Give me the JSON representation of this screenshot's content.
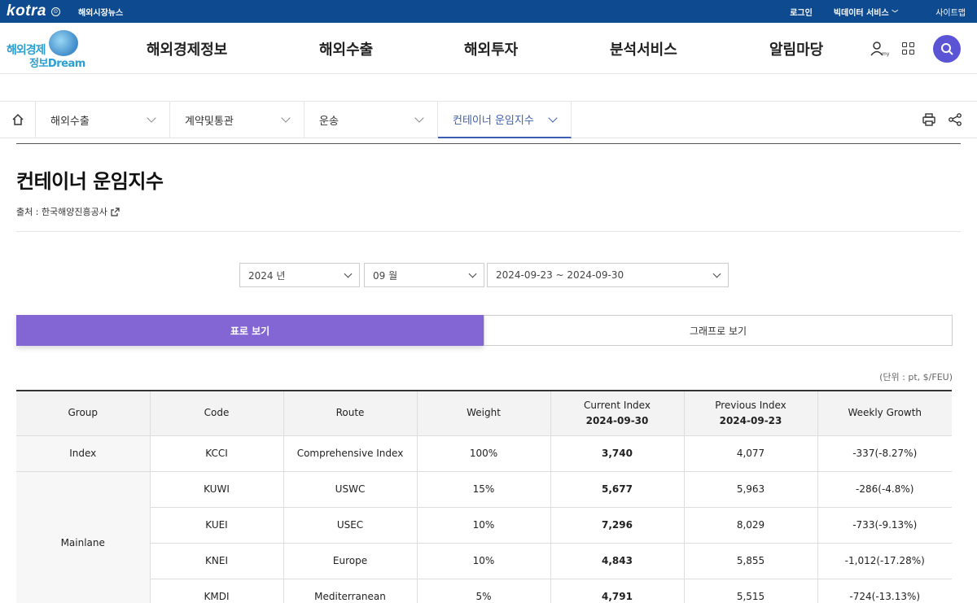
{
  "topbar": {
    "logo": "kotra",
    "news": "해외시장뉴스",
    "login": "로그인",
    "bigdata": "빅데이터 서비스",
    "sitemap": "사이트맵"
  },
  "brand": {
    "line1": "해외경제",
    "line2": "정보Dream"
  },
  "gnb": [
    "해외경제정보",
    "해외수출",
    "해외투자",
    "분석서비스",
    "알림마당"
  ],
  "breadcrumb": [
    "해외수출",
    "계약및통관",
    "운송",
    "컨테이너 운임지수"
  ],
  "page": {
    "title": "컨테이너 운임지수",
    "source": "출처 : 한국해양진흥공사"
  },
  "filters": {
    "year": "2024 년",
    "month": "09 월",
    "week": "2024-09-23 ~ 2024-09-30"
  },
  "tabs": {
    "table": "표로 보기",
    "graph": "그래프로 보기"
  },
  "unit": "(단위 : pt, $/FEU)",
  "table": {
    "headers": {
      "group": "Group",
      "code": "Code",
      "route": "Route",
      "weight": "Weight",
      "current": "Current Index",
      "current_date": "2024-09-30",
      "previous": "Previous Index",
      "previous_date": "2024-09-23",
      "growth": "Weekly Growth"
    },
    "index_group": "Index",
    "mainlane_group": "Mainlane",
    "rows": [
      {
        "code": "KCCI",
        "route": "Comprehensive Index",
        "weight": "100%",
        "current": "3,740",
        "previous": "4,077",
        "growth": "-337(-8.27%)"
      },
      {
        "code": "KUWI",
        "route": "USWC",
        "weight": "15%",
        "current": "5,677",
        "previous": "5,963",
        "growth": "-286(-4.8%)"
      },
      {
        "code": "KUEI",
        "route": "USEC",
        "weight": "10%",
        "current": "7,296",
        "previous": "8,029",
        "growth": "-733(-9.13%)"
      },
      {
        "code": "KNEI",
        "route": "Europe",
        "weight": "10%",
        "current": "4,843",
        "previous": "5,855",
        "growth": "-1,012(-17.28%)"
      },
      {
        "code": "KMDI",
        "route": "Mediterranean",
        "weight": "5%",
        "current": "4,791",
        "previous": "5,515",
        "growth": "-724(-13.13%)"
      }
    ]
  },
  "colors": {
    "topbar": "#0d4a8f",
    "accent_tab": "#8366d3",
    "search": "#5b55d6",
    "active_crumb": "#3a5fb0"
  }
}
